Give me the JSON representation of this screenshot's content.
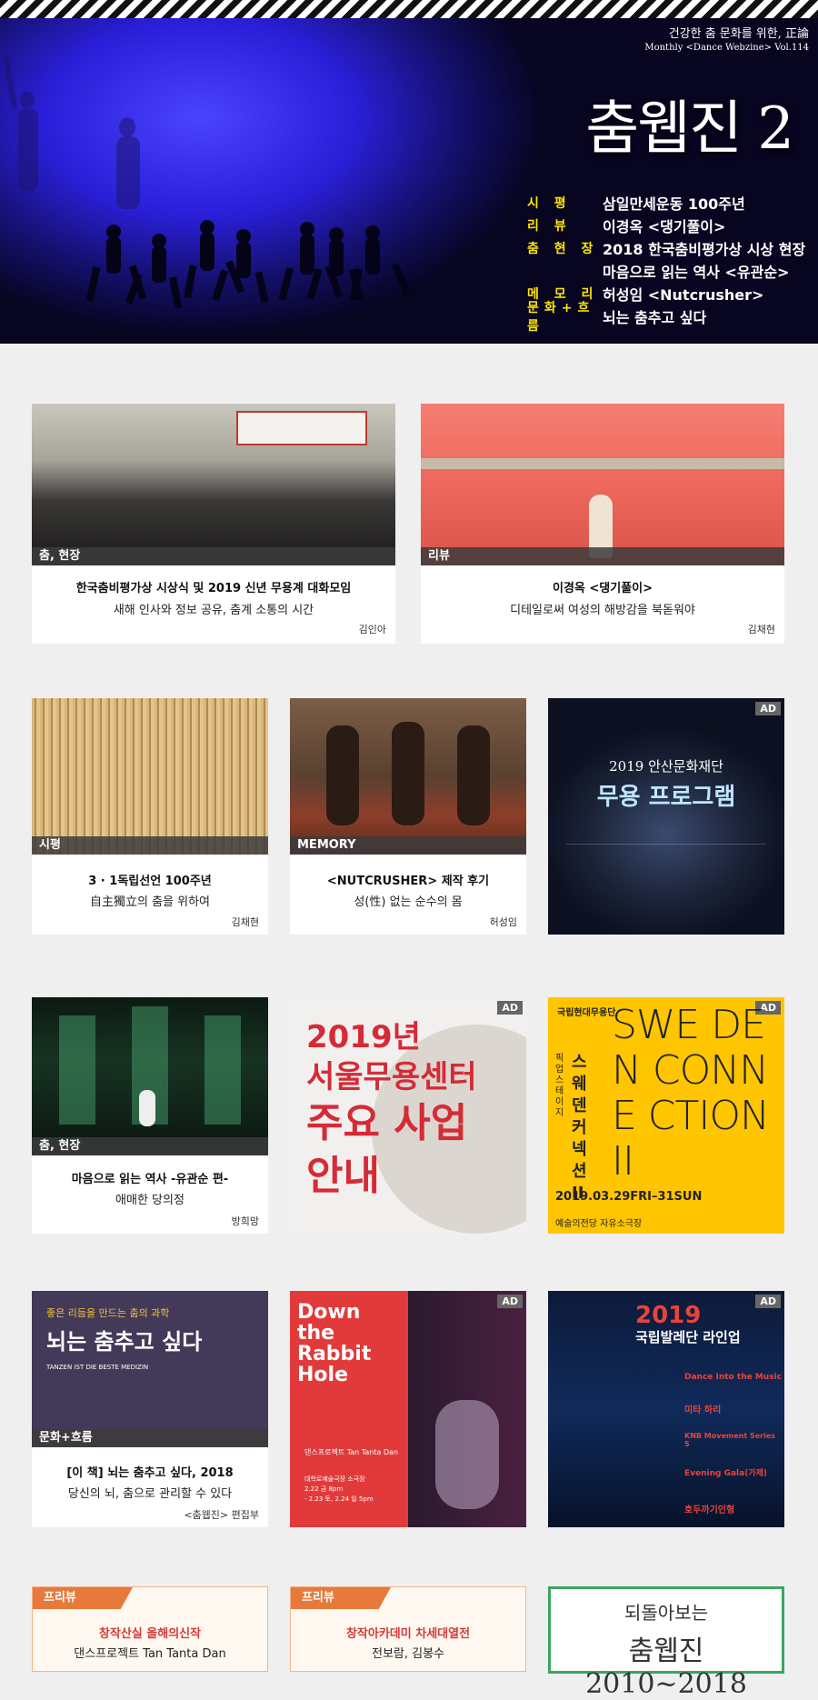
{
  "header": {
    "tagline": "건강한 춤 문화를 위한, 正論",
    "issue": "Monthly <Dance Webzine> Vol.114",
    "title": "춤웹진 2",
    "toc": [
      {
        "label": "시 평",
        "text": "삼일만세운동 100주년"
      },
      {
        "label": "리 뷰",
        "text": "이경옥 <댕기풀이>"
      },
      {
        "label": "춤 현 장",
        "text": "2018 한국춤비평가상 시상 현장"
      },
      {
        "label": "",
        "text": "마음으로 읽는 역사 <유관순>"
      },
      {
        "label": "메 모 리",
        "text": "허성임 <Nutcrusher>"
      },
      {
        "label": "문화+흐름",
        "text": "뇌는 춤추고 싶다"
      }
    ]
  },
  "articles": [
    {
      "badge": "춤, 현장",
      "title": "한국춤비평가상 시상식 및 2019 신년 무용계 대화모임",
      "subtitle": "새해 인사와 정보 공유, 춤계 소통의 시간",
      "author": "김인아"
    },
    {
      "badge": "리뷰",
      "title": "이경옥 <댕기풀이>",
      "subtitle": "디테일로써 여성의 해방감을 북돋워야",
      "author": "김채현"
    },
    {
      "badge": "시평",
      "title": "3 · 1독립선언 100주년",
      "subtitle": "自主獨立의 춤을 위하여",
      "author": "김채현"
    },
    {
      "badge": "MEMORY",
      "title": "<NUTCRUSHER> 제작 후기",
      "subtitle": "성(性) 없는 순수의 몸",
      "author": "허성임"
    },
    {
      "badge": "춤, 현장",
      "title": "마음으로 읽는 역사 -유관순 편-",
      "subtitle": "애매한 당의정",
      "author": "방희망"
    },
    {
      "badge": "문화+흐름",
      "title": "[이 책] 뇌는 춤추고 싶다, 2018",
      "subtitle": "당신의 뇌, 춤으로 관리할 수 있다",
      "author": "<춤웹진> 편집부"
    }
  ],
  "ads": {
    "tag": "AD",
    "ansan": {
      "line1": "2019 안산문화재단",
      "line2": "무용 프로그램"
    },
    "seoul": {
      "line1": "2019년",
      "line2": "서울무용센터",
      "line3": "주요 사업",
      "line4": "안내"
    },
    "sweden": {
      "logo": "국립현대무용단",
      "side": "픽업스테이지",
      "kor": "스웨덴 커넥션 II",
      "big": "SWE DEN CONNE CTION II",
      "date": "2019.03.29FRI–31SUN",
      "venue": "예술의전당 자유소극장"
    },
    "brain_book": {
      "kicker": "좋은 리듬을 만드는 춤의 과학",
      "title": "뇌는 춤추고 싶다",
      "sub": "TANZEN IST DIE BESTE MEDIZIN"
    },
    "rabbit": {
      "title": "Down the Rabbit Hole",
      "company": "댄스프로젝트 Tan Tanta Dan",
      "venue": "대학로예술극장 소극장",
      "date1": "2.22 금 8pm",
      "date2": "- 2.23 토, 2.24 일 5pm"
    },
    "ballet": {
      "year": "2019",
      "title": "국립발레단 라인업",
      "items": [
        "Dance Into the Music",
        "미타 하리",
        "KNB Movement Series 5",
        "Evening Gala(가제)",
        "호두까기인형"
      ]
    }
  },
  "previews": [
    {
      "label": "프리뷰",
      "title": "창작산실 올해의신작",
      "sub": "댄스프로젝트 Tan Tanta Dan"
    },
    {
      "label": "프리뷰",
      "title": "창작아카데미 차세대열전",
      "sub": "전보람, 김봉수"
    }
  ],
  "archive": {
    "line1": "되돌아보는",
    "line2": "춤웹진 2010~2018"
  }
}
